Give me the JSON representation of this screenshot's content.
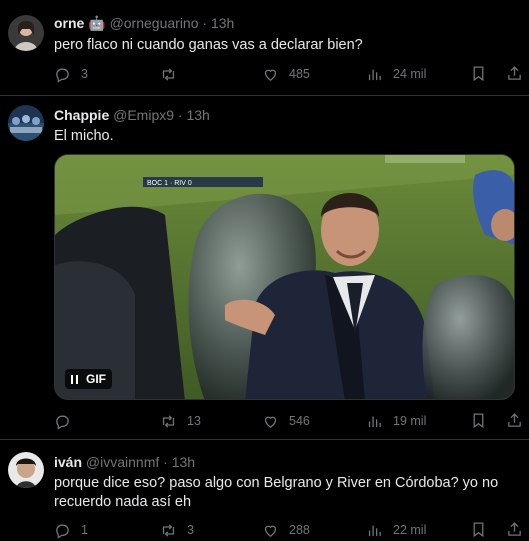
{
  "tweets": [
    {
      "name": "orne",
      "badge": "🤖",
      "handle": "@orneguarino",
      "time": "13h",
      "text": "pero flaco ni cuando ganas vas a declarar bien?",
      "replies": "3",
      "retweets": "",
      "likes": "485",
      "views": "24 mil"
    },
    {
      "name": "Chappie",
      "handle": "@Emipx9",
      "time": "13h",
      "text": "El micho.",
      "media_label": "GIF",
      "scoreboard": "BOC 1 · RIV 0",
      "replies": "",
      "retweets": "13",
      "likes": "546",
      "views": "19 mil"
    },
    {
      "name": "iván",
      "handle": "@ivvainnmf",
      "time": "13h",
      "text": "porque dice eso? paso algo con Belgrano y River en Córdoba? yo no recuerdo nada así eh",
      "replies": "1",
      "retweets": "3",
      "likes": "288",
      "views": "22 mil"
    }
  ],
  "colors": {
    "background": "#000000",
    "border": "#2f3336",
    "muted": "#71767b",
    "text": "#e7e9ea"
  },
  "icons": [
    "reply-icon",
    "retweet-icon",
    "like-icon",
    "views-icon",
    "bookmark-icon",
    "share-icon"
  ]
}
